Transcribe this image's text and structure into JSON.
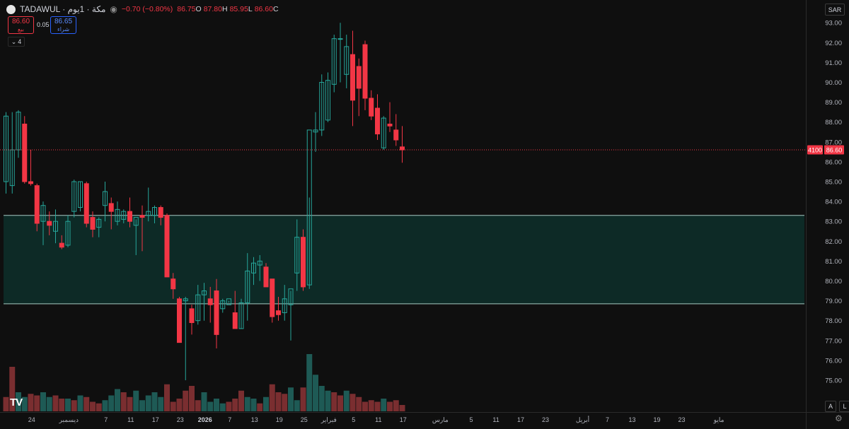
{
  "header": {
    "symbol": "TADAWUL · مكة · 1يوم",
    "change": "−0.70 (−0.80%)",
    "ohlc": [
      {
        "k": "O",
        "v": "86.75"
      },
      {
        "k": "H",
        "v": "87.80"
      },
      {
        "k": "L",
        "v": "85.95"
      },
      {
        "k": "C",
        "v": "86.60"
      }
    ]
  },
  "trade": {
    "sell_price": "86.60",
    "sell_label": "بيع",
    "buy_price": "86.65",
    "buy_label": "شراء",
    "spread": "0.05"
  },
  "indicators_count": "4",
  "currency": "SAR",
  "price_tag": {
    "volume": "4100",
    "price": "86.60"
  },
  "buttons": {
    "auto": "A",
    "log": "L"
  },
  "colors": {
    "up": "#26a69a",
    "down": "#f23645",
    "zone_fill": "#0d2a26",
    "zone_line": "#a7c9c4",
    "bg": "#0f0f0f"
  },
  "chart_data": {
    "type": "candlestick",
    "y_ticks": [
      "75.00",
      "76.00",
      "77.00",
      "78.00",
      "79.00",
      "80.00",
      "81.00",
      "82.00",
      "83.00",
      "84.00",
      "85.00",
      "86.00",
      "87.00",
      "88.00",
      "89.00",
      "90.00",
      "91.00",
      "92.00",
      "93.00"
    ],
    "ylim": [
      74.4,
      93.2
    ],
    "x_tick_labels": [
      {
        "label": "24",
        "i": 4
      },
      {
        "label": "ديسمبر",
        "i": 10
      },
      {
        "label": "7",
        "i": 16
      },
      {
        "label": "11",
        "i": 20
      },
      {
        "label": "17",
        "i": 24
      },
      {
        "label": "23",
        "i": 28
      },
      {
        "label": "2026",
        "i": 32
      },
      {
        "label": "7",
        "i": 36
      },
      {
        "label": "13",
        "i": 40
      },
      {
        "label": "19",
        "i": 44
      },
      {
        "label": "25",
        "i": 48
      },
      {
        "label": "فبراير",
        "i": 52
      },
      {
        "label": "5",
        "i": 56
      },
      {
        "label": "11",
        "i": 60
      },
      {
        "label": "17",
        "i": 64
      },
      {
        "label": "مارس",
        "i": 70
      },
      {
        "label": "5",
        "i": 75
      },
      {
        "label": "11",
        "i": 79
      },
      {
        "label": "17",
        "i": 83
      },
      {
        "label": "23",
        "i": 87
      },
      {
        "label": "أبريل",
        "i": 93
      },
      {
        "label": "7",
        "i": 97
      },
      {
        "label": "13",
        "i": 101
      },
      {
        "label": "19",
        "i": 105
      },
      {
        "label": "23",
        "i": 109
      },
      {
        "label": "مايو",
        "i": 115
      }
    ],
    "zone": {
      "top": 83.3,
      "bottom": 78.85
    },
    "last_price": 86.6,
    "candles": [
      {
        "o": 85.0,
        "h": 88.5,
        "l": 84.4,
        "c": 88.3
      },
      {
        "o": 84.8,
        "h": 88.5,
        "l": 84.4,
        "c": 86.6
      },
      {
        "o": 86.6,
        "h": 88.6,
        "l": 86.2,
        "c": 88.5
      },
      {
        "o": 87.9,
        "h": 88.3,
        "l": 84.9,
        "c": 85.0
      },
      {
        "o": 85.0,
        "h": 86.6,
        "l": 84.8,
        "c": 84.9
      },
      {
        "o": 84.8,
        "h": 84.9,
        "l": 82.5,
        "c": 82.9
      },
      {
        "o": 83.0,
        "h": 84.0,
        "l": 81.8,
        "c": 83.8
      },
      {
        "o": 83.0,
        "h": 83.5,
        "l": 82.3,
        "c": 82.8
      },
      {
        "o": 82.5,
        "h": 83.6,
        "l": 81.9,
        "c": 83.0
      },
      {
        "o": 81.9,
        "h": 82.3,
        "l": 81.6,
        "c": 81.7
      },
      {
        "o": 81.8,
        "h": 83.3,
        "l": 81.7,
        "c": 83.0
      },
      {
        "o": 83.5,
        "h": 85.1,
        "l": 83.2,
        "c": 85.0
      },
      {
        "o": 83.7,
        "h": 85.0,
        "l": 83.5,
        "c": 85.0
      },
      {
        "o": 84.9,
        "h": 85.0,
        "l": 82.7,
        "c": 82.9
      },
      {
        "o": 83.2,
        "h": 83.5,
        "l": 82.2,
        "c": 82.6
      },
      {
        "o": 82.7,
        "h": 83.2,
        "l": 82.2,
        "c": 83.1
      },
      {
        "o": 83.8,
        "h": 85.0,
        "l": 83.0,
        "c": 84.5
      },
      {
        "o": 83.9,
        "h": 84.2,
        "l": 82.6,
        "c": 83.5
      },
      {
        "o": 83.0,
        "h": 84.0,
        "l": 82.8,
        "c": 83.6
      },
      {
        "o": 83.1,
        "h": 83.6,
        "l": 82.9,
        "c": 83.5
      },
      {
        "o": 83.5,
        "h": 84.2,
        "l": 82.7,
        "c": 83.0
      },
      {
        "o": 82.8,
        "h": 83.1,
        "l": 81.3,
        "c": 83.2
      },
      {
        "o": 83.3,
        "h": 83.8,
        "l": 81.5,
        "c": 83.2
      },
      {
        "o": 83.3,
        "h": 84.7,
        "l": 83.0,
        "c": 83.5
      },
      {
        "o": 83.3,
        "h": 83.8,
        "l": 82.9,
        "c": 83.7
      },
      {
        "o": 83.7,
        "h": 83.8,
        "l": 82.8,
        "c": 83.2
      },
      {
        "o": 83.3,
        "h": 83.4,
        "l": 80.2,
        "c": 80.2
      },
      {
        "o": 80.1,
        "h": 80.4,
        "l": 79.1,
        "c": 79.6
      },
      {
        "o": 79.1,
        "h": 79.2,
        "l": 76.9,
        "c": 76.9
      },
      {
        "o": 79.0,
        "h": 79.2,
        "l": 75.0,
        "c": 79.1
      },
      {
        "o": 78.6,
        "h": 78.8,
        "l": 77.3,
        "c": 77.9
      },
      {
        "o": 78.0,
        "h": 79.8,
        "l": 77.8,
        "c": 79.3
      },
      {
        "o": 79.3,
        "h": 79.9,
        "l": 78.0,
        "c": 79.5
      },
      {
        "o": 79.1,
        "h": 79.7,
        "l": 77.9,
        "c": 78.8
      },
      {
        "o": 79.5,
        "h": 80.1,
        "l": 76.6,
        "c": 77.3
      },
      {
        "o": 78.6,
        "h": 79.1,
        "l": 78.4,
        "c": 79.0
      },
      {
        "o": 78.8,
        "h": 79.0,
        "l": 78.9,
        "c": 79.1
      },
      {
        "o": 78.4,
        "h": 79.5,
        "l": 78.2,
        "c": 77.6
      },
      {
        "o": 77.6,
        "h": 79.1,
        "l": 77.6,
        "c": 78.9
      },
      {
        "o": 78.9,
        "h": 81.4,
        "l": 78.0,
        "c": 80.5
      },
      {
        "o": 80.4,
        "h": 81.2,
        "l": 79.8,
        "c": 80.9
      },
      {
        "o": 80.8,
        "h": 81.3,
        "l": 80.0,
        "c": 81.0
      },
      {
        "o": 80.7,
        "h": 80.9,
        "l": 79.7,
        "c": 79.7
      },
      {
        "o": 80.1,
        "h": 80.1,
        "l": 77.9,
        "c": 78.2
      },
      {
        "o": 78.5,
        "h": 79.2,
        "l": 78.0,
        "c": 78.3
      },
      {
        "o": 78.4,
        "h": 79.8,
        "l": 78.0,
        "c": 79.1
      },
      {
        "o": 78.8,
        "h": 79.5,
        "l": 77.0,
        "c": 79.6
      },
      {
        "o": 80.4,
        "h": 83.1,
        "l": 79.5,
        "c": 82.2
      },
      {
        "o": 82.2,
        "h": 82.6,
        "l": 79.5,
        "c": 79.7
      },
      {
        "o": 79.8,
        "h": 84.2,
        "l": 79.6,
        "c": 87.6
      },
      {
        "o": 87.5,
        "h": 88.5,
        "l": 86.5,
        "c": 87.6
      },
      {
        "o": 87.6,
        "h": 90.4,
        "l": 87.3,
        "c": 90.0
      },
      {
        "o": 88.1,
        "h": 90.5,
        "l": 88.0,
        "c": 90.1
      },
      {
        "o": 89.9,
        "h": 92.4,
        "l": 89.5,
        "c": 92.2
      },
      {
        "o": 92.2,
        "h": 93.0,
        "l": 90.0,
        "c": 92.2
      },
      {
        "o": 90.4,
        "h": 92.4,
        "l": 89.7,
        "c": 91.8
      },
      {
        "o": 91.4,
        "h": 92.6,
        "l": 87.8,
        "c": 89.1
      },
      {
        "o": 90.8,
        "h": 91.2,
        "l": 88.3,
        "c": 89.7
      },
      {
        "o": 91.9,
        "h": 92.1,
        "l": 88.6,
        "c": 89.2
      },
      {
        "o": 89.2,
        "h": 89.6,
        "l": 88.1,
        "c": 88.3
      },
      {
        "o": 88.7,
        "h": 89.4,
        "l": 87.1,
        "c": 87.4
      },
      {
        "o": 86.7,
        "h": 88.3,
        "l": 86.6,
        "c": 88.2
      },
      {
        "o": 87.9,
        "h": 89.0,
        "l": 87.5,
        "c": 87.8
      },
      {
        "o": 87.6,
        "h": 88.4,
        "l": 86.8,
        "c": 87.1
      },
      {
        "o": 86.75,
        "h": 87.8,
        "l": 85.95,
        "c": 86.6
      }
    ],
    "volume": [
      {
        "v": 9,
        "up": false
      },
      {
        "v": 28,
        "up": false
      },
      {
        "v": 12,
        "up": true
      },
      {
        "v": 9,
        "up": true
      },
      {
        "v": 11,
        "up": false
      },
      {
        "v": 10,
        "up": false
      },
      {
        "v": 12,
        "up": true
      },
      {
        "v": 9,
        "up": true
      },
      {
        "v": 10,
        "up": false
      },
      {
        "v": 8,
        "up": false
      },
      {
        "v": 8,
        "up": true
      },
      {
        "v": 7,
        "up": false
      },
      {
        "v": 10,
        "up": true
      },
      {
        "v": 9,
        "up": false
      },
      {
        "v": 6,
        "up": false
      },
      {
        "v": 5,
        "up": false
      },
      {
        "v": 7,
        "up": true
      },
      {
        "v": 10,
        "up": true
      },
      {
        "v": 14,
        "up": true
      },
      {
        "v": 12,
        "up": false
      },
      {
        "v": 9,
        "up": false
      },
      {
        "v": 13,
        "up": true
      },
      {
        "v": 7,
        "up": true
      },
      {
        "v": 10,
        "up": true
      },
      {
        "v": 12,
        "up": true
      },
      {
        "v": 9,
        "up": true
      },
      {
        "v": 17,
        "up": false
      },
      {
        "v": 6,
        "up": false
      },
      {
        "v": 8,
        "up": false
      },
      {
        "v": 13,
        "up": false
      },
      {
        "v": 16,
        "up": false
      },
      {
        "v": 7,
        "up": false
      },
      {
        "v": 12,
        "up": true
      },
      {
        "v": 6,
        "up": true
      },
      {
        "v": 8,
        "up": true
      },
      {
        "v": 5,
        "up": true
      },
      {
        "v": 6,
        "up": false
      },
      {
        "v": 8,
        "up": false
      },
      {
        "v": 13,
        "up": false
      },
      {
        "v": 9,
        "up": true
      },
      {
        "v": 8,
        "up": true
      },
      {
        "v": 5,
        "up": false
      },
      {
        "v": 9,
        "up": true
      },
      {
        "v": 17,
        "up": false
      },
      {
        "v": 12,
        "up": false
      },
      {
        "v": 11,
        "up": false
      },
      {
        "v": 15,
        "up": true
      },
      {
        "v": 7,
        "up": true
      },
      {
        "v": 15,
        "up": false
      },
      {
        "v": 36,
        "up": true
      },
      {
        "v": 23,
        "up": true
      },
      {
        "v": 16,
        "up": true
      },
      {
        "v": 13,
        "up": true
      },
      {
        "v": 12,
        "up": false
      },
      {
        "v": 10,
        "up": false
      },
      {
        "v": 13,
        "up": true
      },
      {
        "v": 11,
        "up": false
      },
      {
        "v": 9,
        "up": false
      },
      {
        "v": 6,
        "up": false
      },
      {
        "v": 7,
        "up": false
      },
      {
        "v": 6,
        "up": false
      },
      {
        "v": 8,
        "up": true
      },
      {
        "v": 6,
        "up": false
      },
      {
        "v": 7,
        "up": false
      },
      {
        "v": 4,
        "up": false
      }
    ]
  }
}
